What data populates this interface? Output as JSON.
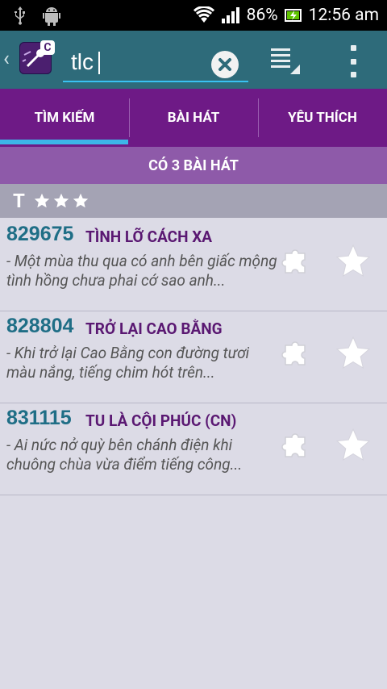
{
  "status_bar": {
    "battery": "86%",
    "time": "12:56 am"
  },
  "action_bar": {
    "search_value": "tlc"
  },
  "tabs": [
    {
      "label": "TÌM KIẾM"
    },
    {
      "label": "BÀI HÁT"
    },
    {
      "label": "YÊU THÍCH"
    }
  ],
  "count_label": "CÓ 3 BÀI HÁT",
  "group": {
    "letter": "T"
  },
  "songs": [
    {
      "code": "829675",
      "title": "TÌNH LỠ CÁCH XA",
      "lyric": "- Một mùa thu qua có anh bên giấc mộng tình hồng chưa phai cớ sao anh..."
    },
    {
      "code": "828804",
      "title": "TRỞ LẠI CAO BẰNG",
      "lyric": "- Khi trở lại Cao Bằng con đường tươi màu nắng, tiếng chim hót trên..."
    },
    {
      "code": "831115",
      "title": "TU LÀ CỘI PHÚC (CN)",
      "lyric": "- Ai nức nở quỳ bên chánh điện khi chuông chùa vừa điểm tiếng công..."
    }
  ]
}
